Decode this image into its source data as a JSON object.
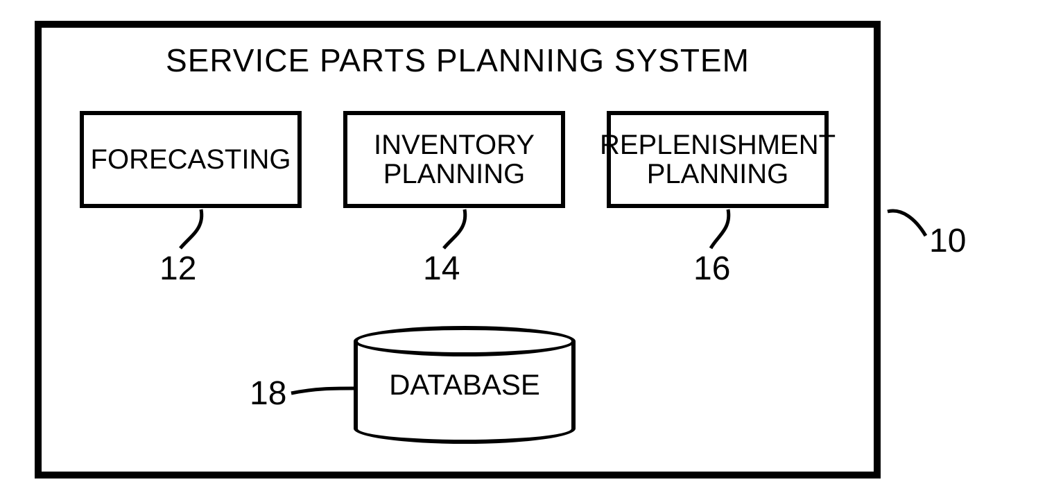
{
  "system": {
    "title": "SERVICE PARTS PLANNING SYSTEM",
    "ref": "10"
  },
  "modules": {
    "forecasting": {
      "label": "FORECASTING",
      "ref": "12"
    },
    "inventory": {
      "label": "INVENTORY\nPLANNING",
      "ref": "14"
    },
    "replenishment": {
      "label": "REPLENISHMENT\nPLANNING",
      "ref": "16"
    }
  },
  "database": {
    "label": "DATABASE",
    "ref": "18"
  }
}
